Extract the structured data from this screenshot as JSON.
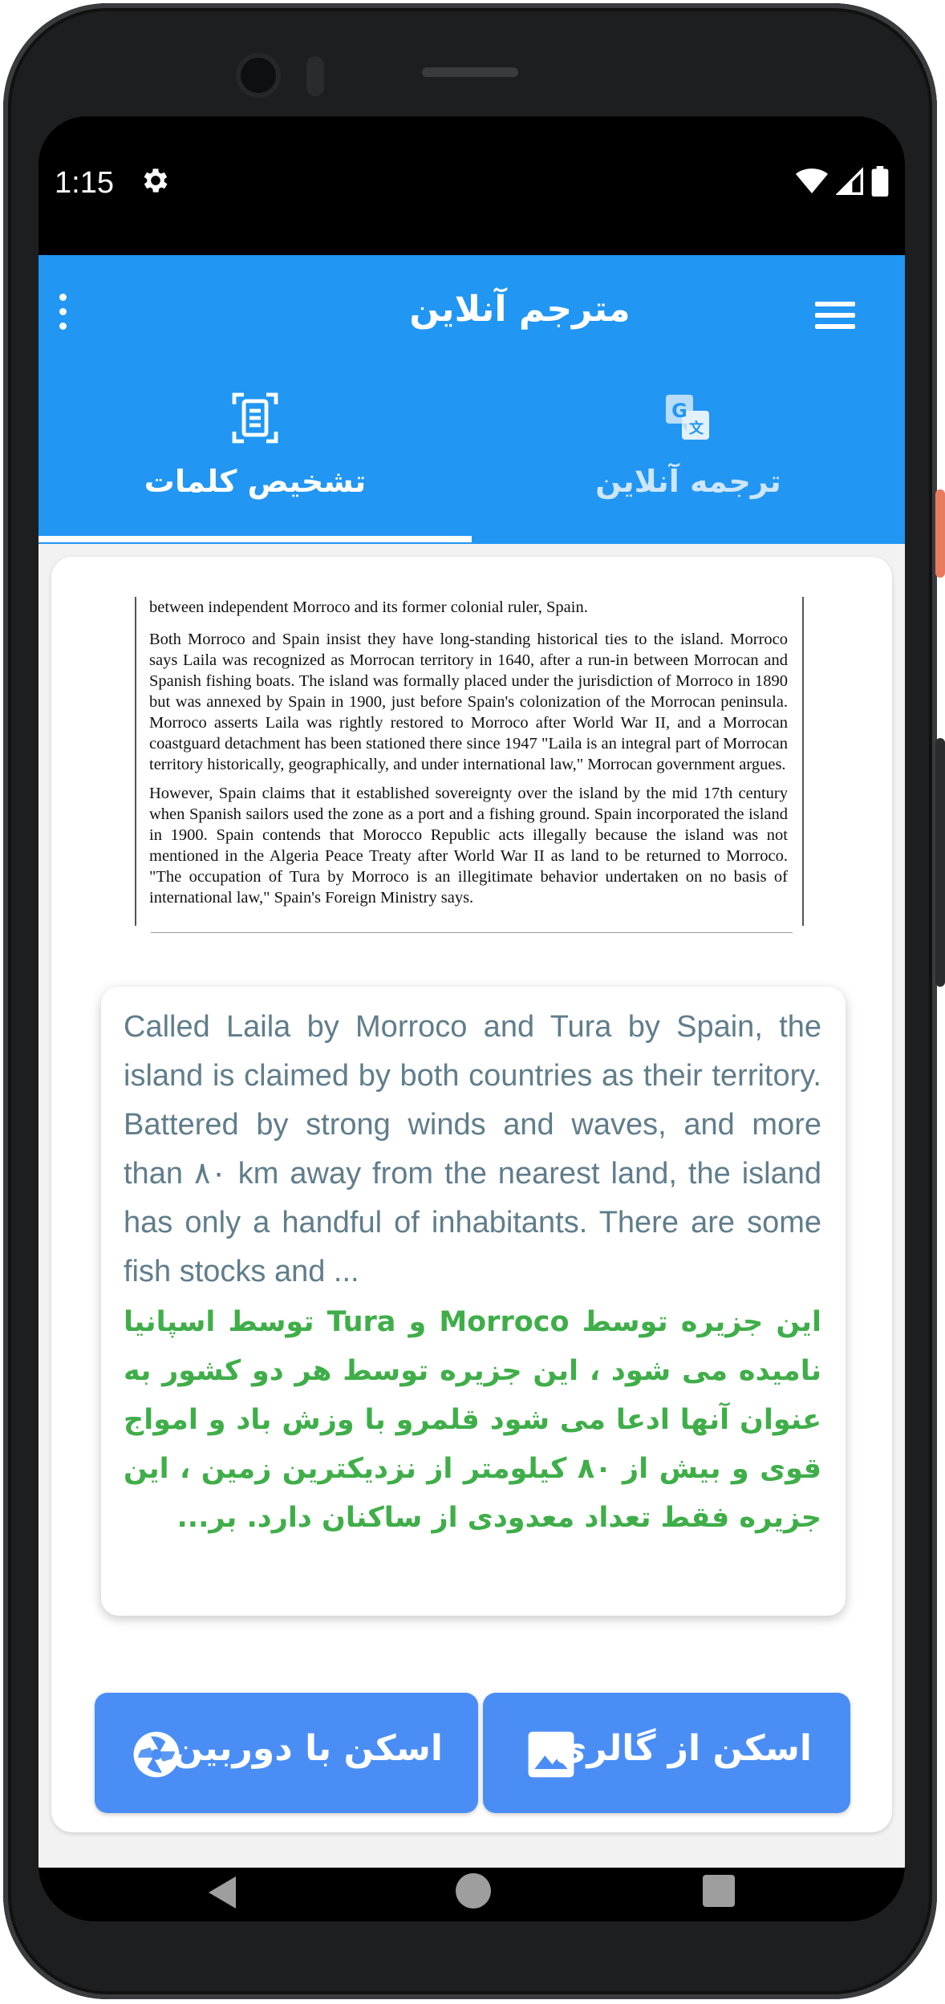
{
  "status": {
    "time": "1:15",
    "settings_icon": "gear-icon",
    "icons": [
      "wifi-icon",
      "signal-icon",
      "battery-icon"
    ]
  },
  "app_bar": {
    "title": "مترجم آنلاین",
    "menu_icon": "hamburger-menu-icon",
    "overflow_icon": "overflow-menu-icon",
    "background": "#2196f3"
  },
  "tabs": [
    {
      "label": "تشخیص کلمات",
      "icon": "document-scan-icon",
      "selected": true
    },
    {
      "label": "ترجمه آنلاین",
      "icon": "translate-icon",
      "selected": false
    }
  ],
  "scanned_document": {
    "lead_line": "between independent Morroco and its former colonial ruler, Spain.",
    "paragraphs": [
      "Both Morroco and Spain insist they have long-standing historical ties to the island. Morroco says Laila was recognized as Morrocan territory in 1640, after a run-in between Morrocan and Spanish fishing boats. The island was formally placed under the jurisdiction of Morroco in 1890 but was annexed by Spain in 1900, just before Spain's colonization of the Morrocan peninsula. Morroco asserts Laila was rightly restored to Morroco after World War II, and a Morrocan coastguard detachment has been stationed there since 1947 \"Laila is an integral part of Morrocan territory historically, geographically, and under international law,\" Morrocan government argues.",
      "However, Spain claims that it established sovereignty over the island by the mid 17th century when Spanish sailors used the zone as a port and a fishing ground. Spain incorporated the island in 1900. Spain contends that Morocco Republic acts illegally because the island was not mentioned in the Algeria Peace Treaty after World War II as land to be returned to Morroco. \"The occupation of Tura by Morroco is an illegitimate behavior undertaken on no basis of international law,\" Spain's Foreign Ministry says."
    ]
  },
  "result": {
    "english": "Called Laila by Morroco and Tura by Spain, the island is claimed by both countries as their territory. Battered by strong winds and waves, and more than ٨٠ km away from the nearest land, the island has only a handful of inhabitants. There are some fish stocks and ...",
    "persian": "این جزیره توسط Morroco و Tura توسط اسپانیا نامیده می شود ، این جزیره توسط هر دو کشور به عنوان آنها ادعا می شود قلمرو با وزش باد و امواج قوی و بیش از ۸۰ کیلومتر از نزدیکترین زمین ، این جزیره فقط تعداد معدودی از ساکنان دارد. بر..."
  },
  "buttons": {
    "camera_label": "اسکن با دوربین",
    "camera_icon": "camera-shutter-icon",
    "gallery_label": "اسکن از گالری",
    "gallery_icon": "image-icon",
    "color": "#4a8ef5"
  },
  "navigation": {
    "icons": [
      "back-icon",
      "home-icon",
      "recent-apps-icon"
    ]
  }
}
